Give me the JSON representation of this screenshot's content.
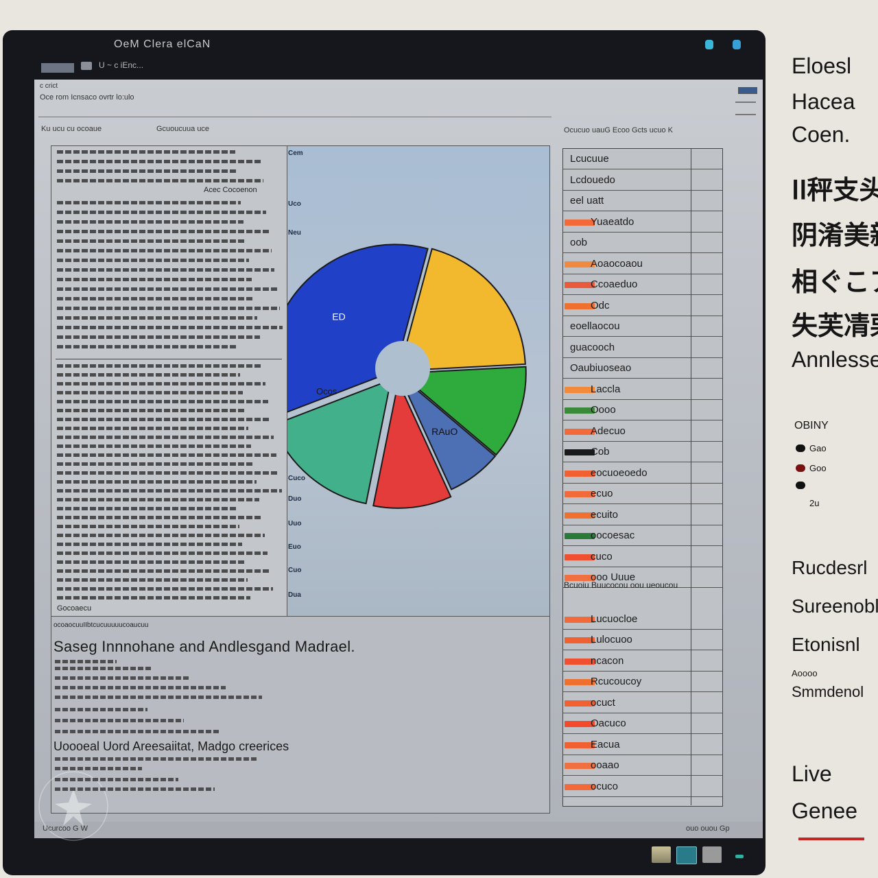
{
  "window": {
    "title": "OeM Clera elCaN",
    "toolbar_text": "U ~ c iEnc..."
  },
  "header": {
    "crumb_top": "c crict",
    "crumb_sub": "Oce rom Icnsaco ovrtr lo:ulo",
    "sub_left": "Ku ucu cu ocoaue",
    "sub_mid": "Gcuoucuua uce",
    "sub_right": "Ocucuo uauG Ecoo Gcts ucuo K"
  },
  "document": {
    "heading": "Acec Cocoenon",
    "footer": "Gocoaecu"
  },
  "chart_data": {
    "type": "pie",
    "values": [
      20,
      12,
      7,
      10,
      16,
      35
    ],
    "colors": [
      "#f2b92e",
      "#2faa3d",
      "#4d6fb3",
      "#e43b3b",
      "#42b08a",
      "#2040c8"
    ],
    "slice_labels": [
      "",
      "",
      "RAuO",
      "",
      "",
      "ED"
    ],
    "ylabels": [
      "Cem",
      "Uco",
      "Neu",
      "Cuco",
      "Duo",
      "Uuo",
      "Euo",
      "Cuo",
      "Dua"
    ],
    "inner_label": "Ocos"
  },
  "section2": {
    "caption": "ocoaocuuIIbtcucuuuuucoaucuu",
    "heading": "Saseg Innnohane and Andlesgand Madrael.",
    "subheading": "Uoooeal Uord Areesaiitat, Madgo creerices"
  },
  "table": {
    "mid_label": "Bcuoiu Buucocou oou ueoucou",
    "rows": [
      {
        "label": "Lcucuue",
        "color": ""
      },
      {
        "label": "Lcdouedo",
        "color": ""
      },
      {
        "label": "eel uatt",
        "color": ""
      },
      {
        "label": "Yuaeatdo",
        "color": "#f26a3a"
      },
      {
        "label": "oob",
        "color": ""
      },
      {
        "label": "Aoaocoaou",
        "color": "#f08a40"
      },
      {
        "label": "Ccoaeduo",
        "color": "#e85a3a"
      },
      {
        "label": "Odc",
        "color": "#f07030"
      },
      {
        "label": "eoellaocou",
        "color": ""
      },
      {
        "label": "guacooch",
        "color": ""
      },
      {
        "label": "Oaubiuoseao",
        "color": ""
      },
      {
        "label": "Laccla",
        "color": "#f28a3a"
      },
      {
        "label": "Oooo",
        "color": "#3a8a3a"
      },
      {
        "label": "Adecuo",
        "color": "#f26a3a"
      },
      {
        "label": "Cob",
        "color": "#1a1a1a"
      },
      {
        "label": "eocuoeoedo",
        "color": "#f06030"
      },
      {
        "label": "ecuo",
        "color": "#f26a3a"
      },
      {
        "label": "ecuito",
        "color": "#f07030"
      },
      {
        "label": "oocoesac",
        "color": "#2a7a3a"
      },
      {
        "label": "cuco",
        "color": "#f05030"
      },
      {
        "label": "ooo Uuue",
        "color": "#f07040"
      },
      {
        "label": "Lucuocloe",
        "color": "#f26a3a"
      },
      {
        "label": "Lulocuoo",
        "color": "#f06030"
      },
      {
        "label": "ncacon",
        "color": "#f05030"
      },
      {
        "label": "Rcucoucoy",
        "color": "#f07030"
      },
      {
        "label": "ocuct",
        "color": "#f06030"
      },
      {
        "label": "Oacuco",
        "color": "#f24a2a"
      },
      {
        "label": "Eacua",
        "color": "#f06030"
      },
      {
        "label": "ooaao",
        "color": "#f07040"
      },
      {
        "label": "ocuco",
        "color": "#f26a3a"
      }
    ]
  },
  "status": {
    "left": "Ucurcoo  G    W",
    "right": "ouo  ouou  Gp"
  },
  "side": {
    "items": [
      "Eloesl",
      "Hacea",
      "Coen.",
      "ⅠⅠ秤支头",
      "阴淆美新",
      "相ぐこア",
      "失芙凊栗",
      "Annlesse"
    ],
    "legend_title": "OBINY",
    "legend": [
      "Gao",
      "Goo",
      "",
      "2u"
    ],
    "items2": [
      "Rucdesrl",
      "Sureenobl",
      "Etonisnl",
      "Aoooo",
      "Smmdenol",
      "Live",
      "Genee"
    ]
  }
}
